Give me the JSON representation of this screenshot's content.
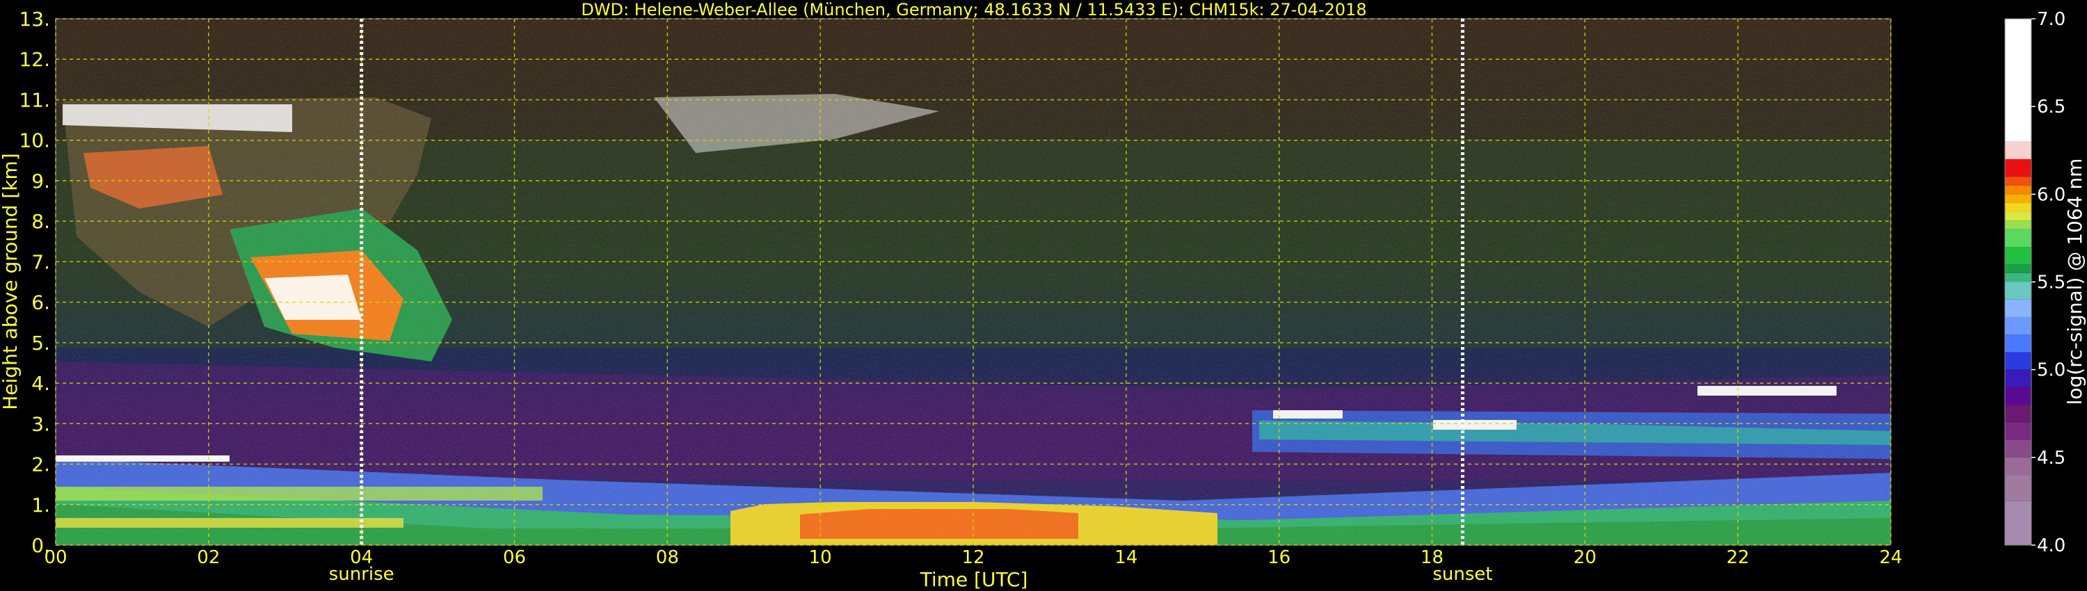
{
  "title": "DWD: Helene-Weber-Allee (München, Germany; 48.1633 N / 11.5433 E):    CHM15k: 27-04-2018",
  "chart_data": {
    "type": "heatmap",
    "title": "DWD: Helene-Weber-Allee (München, Germany; 48.1633 N / 11.5433 E):    CHM15k: 27-04-2018",
    "xlabel": "Time [UTC]",
    "ylabel": "Height above ground [km]",
    "colorbar_label": "log(rc-signal) @ 1064 nm",
    "xlim": [
      0,
      24
    ],
    "ylim": [
      0,
      13
    ],
    "x_ticks": [
      "00",
      "02",
      "04",
      "06",
      "08",
      "10",
      "12",
      "14",
      "16",
      "18",
      "20",
      "22",
      "24"
    ],
    "y_ticks": [
      "0.",
      "1.",
      "2.",
      "3.",
      "4.",
      "5.",
      "6.",
      "7.",
      "8.",
      "9.",
      "10.",
      "11.",
      "12.",
      "13."
    ],
    "colorbar_range": [
      4.0,
      7.0
    ],
    "colorbar_ticks": [
      "4.0",
      "4.5",
      "5.0",
      "5.5",
      "6.0",
      "6.5",
      "7.0"
    ],
    "grid": true,
    "markers": [
      {
        "label": "sunrise",
        "time": 4.0
      },
      {
        "label": "sunset",
        "time": 18.4
      }
    ]
  },
  "colors": {
    "text": "#ffff33",
    "colorbar_text": "#ffffff",
    "background": "#000000"
  }
}
